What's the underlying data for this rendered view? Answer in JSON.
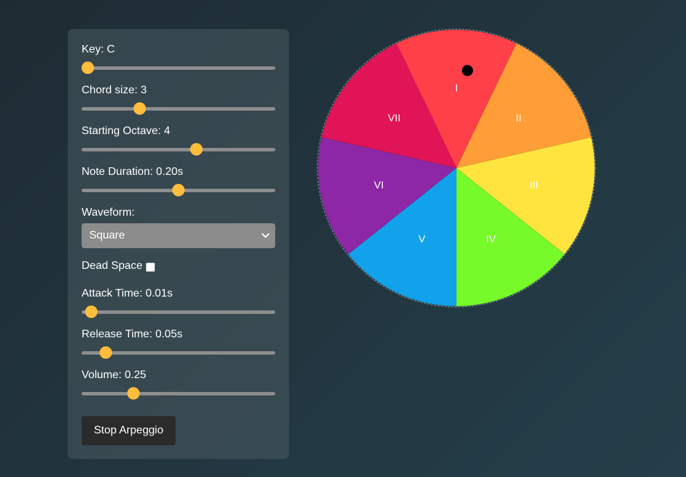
{
  "controls": {
    "key": {
      "label": "Key: C",
      "value": 0,
      "min": 0,
      "max": 11
    },
    "chord_size": {
      "label": "Chord size: 3",
      "value": 3,
      "min": 1,
      "max": 8
    },
    "starting_octave": {
      "label": "Starting Octave: 4",
      "value": 4,
      "min": 1,
      "max": 6
    },
    "note_duration": {
      "label": "Note Duration: 0.20s",
      "value": 0.2,
      "min": 0.05,
      "max": 0.35
    },
    "waveform": {
      "label": "Waveform:",
      "selected": "Square"
    },
    "dead_space": {
      "label": "Dead Space",
      "checked": false
    },
    "attack_time": {
      "label": "Attack Time: 0.01s",
      "value": 0.01,
      "min": 0,
      "max": 0.5
    },
    "release_time": {
      "label": "Release Time: 0.05s",
      "value": 0.05,
      "min": 0,
      "max": 0.5
    },
    "volume": {
      "label": "Volume: 0.25",
      "value": 0.25,
      "min": 0,
      "max": 1
    },
    "stop_button": {
      "label": "Stop Arpeggio"
    }
  },
  "wheel": {
    "segments": [
      {
        "label": "I",
        "color": "#ff4049"
      },
      {
        "label": "II",
        "color": "#ff9e36"
      },
      {
        "label": "III",
        "color": "#ffe43f"
      },
      {
        "label": "IV",
        "color": "#76fa29"
      },
      {
        "label": "V",
        "color": "#12a1eb"
      },
      {
        "label": "VI",
        "color": "#8d27a6"
      },
      {
        "label": "VII",
        "color": "#e11457"
      }
    ],
    "marker_color": "#000000"
  },
  "theme": {
    "thumb_color": "#ffbd3c",
    "track_color": "#8e8e8e"
  }
}
